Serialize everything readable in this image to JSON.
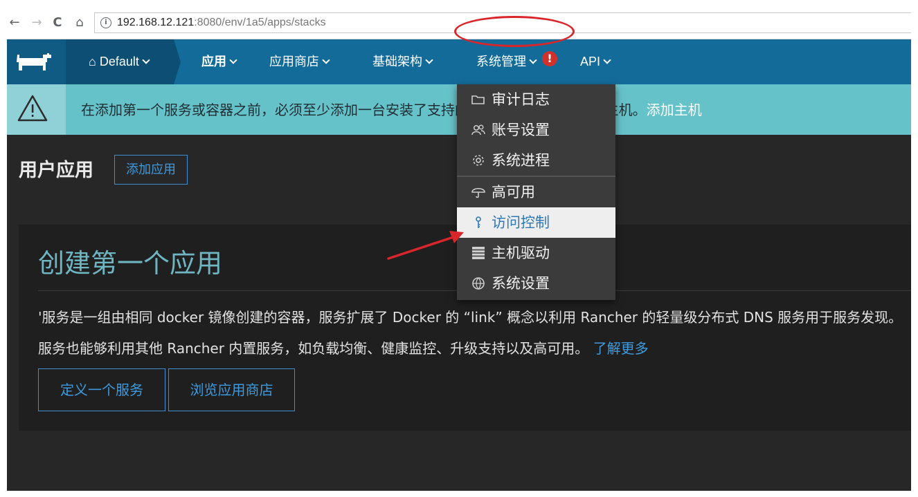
{
  "browser": {
    "url_host": "192.168.12.121",
    "url_rest": ":8080/env/1a5/apps/stacks",
    "back_icon": "←",
    "forward_icon": "→",
    "reload_icon": "C",
    "home_icon": "⌂",
    "info_icon": "i"
  },
  "header": {
    "environment": "Default",
    "home_glyph": "⌂",
    "nav": [
      "应用",
      "应用商店",
      "基础架构",
      "系统管理",
      "API"
    ],
    "alert_glyph": "!"
  },
  "banner": {
    "text": "在添加第一个服务或容器之前，必须至少添加一台安装了支持的Docker版本的 Linux 主机。",
    "link": "添加主机"
  },
  "page": {
    "title": "用户应用",
    "add_button": "添加应用"
  },
  "card": {
    "title": "创建第一个应用",
    "line1": "'服务是一组由相同 docker 镜像创建的容器，服务扩展了 Docker 的 “link” 概念以利用 Rancher 的轻量级分布式 DNS 服务用于服务发现。",
    "line2": "服务也能够利用其他 Rancher 内置服务，如负载均衡、健康监控、升级支持以及高可用。",
    "learn_more": "了解更多",
    "btn_define": "定义一个服务",
    "btn_browse": "浏览应用商店"
  },
  "dropdown": {
    "items": [
      {
        "label": "审计日志",
        "icon": "folder-icon"
      },
      {
        "label": "账号设置",
        "icon": "users-icon"
      },
      {
        "label": "系统进程",
        "icon": "gear-icon"
      },
      {
        "label": "高可用",
        "icon": "umbrella-icon"
      },
      {
        "label": "访问控制",
        "icon": "key-icon",
        "selected": true
      },
      {
        "label": "主机驱动",
        "icon": "server-icon"
      },
      {
        "label": "系统设置",
        "icon": "globe-icon"
      }
    ]
  },
  "colors": {
    "header": "#136b99",
    "banner": "#66c2c9",
    "accent": "#3d9be0",
    "annotation": "#d9262b"
  }
}
